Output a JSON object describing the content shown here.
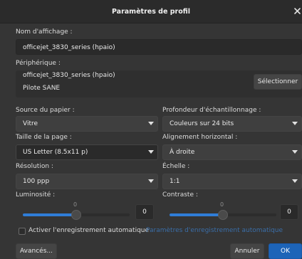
{
  "dialog": {
    "title": "Paramètres de profil"
  },
  "display_name": {
    "label": "Nom d'affichage :",
    "value": "officejet_3830_series (hpaio)"
  },
  "device": {
    "label": "Périphérique :",
    "name": "officejet_3830_series (hpaio)",
    "driver": "Pilote SANE",
    "select_button": "Sélectionner"
  },
  "paper_source": {
    "label": "Source du papier :",
    "value": "Vitre"
  },
  "sample_depth": {
    "label": "Profondeur d'échantillonnage :",
    "value": "Couleurs sur 24 bits"
  },
  "page_size": {
    "label": "Taille de la page :",
    "value": "US Letter (8.5x11 p)"
  },
  "horizontal_alignment": {
    "label": "Alignement horizontal :",
    "value": "À droite"
  },
  "resolution": {
    "label": "Résolution :",
    "value": "100 ppp"
  },
  "scale": {
    "label": "Échelle :",
    "value": "1:1"
  },
  "brightness": {
    "label": "Luminosité :",
    "tick": "0",
    "value": "0",
    "level": 0.5
  },
  "contrast": {
    "label": "Contraste :",
    "tick": "0",
    "value": "0",
    "level": 0.5
  },
  "auto_save": {
    "checkbox_label": "Activer l'enregistrement automatique",
    "settings_link": "Paramètres d'enregistrement automatique"
  },
  "footer": {
    "advanced_button": "Avancés...",
    "cancel_button": "Annuler",
    "ok_button": "OK"
  },
  "colors": {
    "accent": "#2f7dd8",
    "ok_button": "#1d64b8",
    "background": "#353535",
    "titlebar": "#2b2b2b",
    "link_disabled": "#3a6ea8"
  }
}
